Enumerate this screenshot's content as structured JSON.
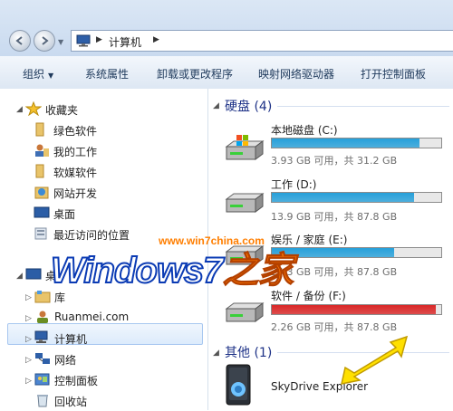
{
  "address": {
    "crumb": "计算机"
  },
  "toolbar": {
    "organize": "组织",
    "system_properties": "系统属性",
    "uninstall": "卸载或更改程序",
    "map_drive": "映射网络驱动器",
    "open_control_panel": "打开控制面板"
  },
  "nav": {
    "favorites": "收藏夹",
    "green_software": "绿色软件",
    "my_work": "我的工作",
    "media_software": "软媒软件",
    "web_dev": "网站开发",
    "desktop": "桌面",
    "recent": "最近访问的位置",
    "desktop_root": "桌",
    "libraries": "库",
    "ruanmei": "Ruanmei.com",
    "computer": "计算机",
    "network": "网络",
    "control_panel": "控制面板",
    "recycle_bin": "回收站"
  },
  "groups": {
    "hard_disks": "硬盘 (4)",
    "other": "其他 (1)"
  },
  "drives": [
    {
      "name": "本地磁盘 (C:)",
      "size": "3.93 GB 可用，共 31.2 GB",
      "used": 0.87,
      "color": "#26a0da"
    },
    {
      "name": "工作 (D:)",
      "size": "13.9 GB 可用，共 87.8 GB",
      "used": 0.84,
      "color": "#26a0da"
    },
    {
      "name": "娱乐 / 家庭 (E:)",
      "size": "24.3 GB 可用，共 87.8 GB",
      "used": 0.72,
      "color": "#26a0da"
    },
    {
      "name": "软件 / 备份 (F:)",
      "size": "2.26 GB 可用，共 87.8 GB",
      "used": 0.97,
      "color": "#da2626"
    }
  ],
  "other_item": "SkyDrive Explorer",
  "watermark": {
    "url": "www.win7china.com",
    "logo": "Windows7",
    "logo_zh": "之家"
  }
}
